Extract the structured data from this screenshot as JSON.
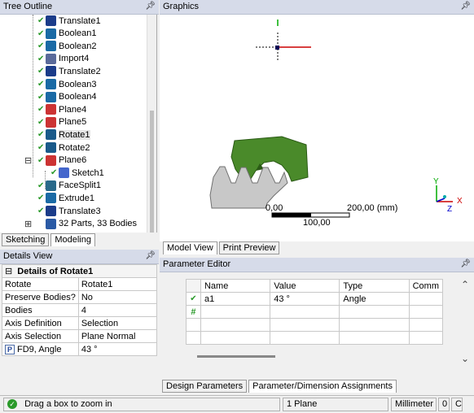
{
  "tree_outline": {
    "title": "Tree Outline",
    "items": [
      {
        "label": "Translate1",
        "icon": "translate-icon"
      },
      {
        "label": "Boolean1",
        "icon": "boolean-icon"
      },
      {
        "label": "Boolean2",
        "icon": "boolean-icon"
      },
      {
        "label": "Import4",
        "icon": "import-icon"
      },
      {
        "label": "Translate2",
        "icon": "translate-icon"
      },
      {
        "label": "Boolean3",
        "icon": "boolean-icon"
      },
      {
        "label": "Boolean4",
        "icon": "boolean-icon"
      },
      {
        "label": "Plane4",
        "icon": "plane-icon"
      },
      {
        "label": "Plane5",
        "icon": "plane-icon"
      },
      {
        "label": "Rotate1",
        "icon": "rotate-icon"
      },
      {
        "label": "Rotate2",
        "icon": "rotate-icon"
      },
      {
        "label": "Plane6",
        "icon": "plane-icon"
      },
      {
        "label": "Sketch1",
        "icon": "sketch-icon"
      },
      {
        "label": "FaceSplit1",
        "icon": "facesplit-icon"
      },
      {
        "label": "Extrude1",
        "icon": "extrude-icon"
      },
      {
        "label": "Translate3",
        "icon": "translate-icon"
      },
      {
        "label": "32 Parts, 33 Bodies",
        "icon": "parts-icon"
      }
    ],
    "tabs": [
      "Sketching",
      "Modeling"
    ],
    "active_tab": "Modeling"
  },
  "graphics": {
    "title": "Graphics",
    "scale_left": "0,00",
    "scale_right": "200,00 (mm)",
    "scale_mid": "100,00",
    "axis_x": "X",
    "axis_y": "Y",
    "axis_z": "Z",
    "tabs": [
      "Model View",
      "Print Preview"
    ],
    "active_tab": "Model View",
    "colors": {
      "green_body": "#4a8a2a",
      "gray_body": "#c8c8c8"
    }
  },
  "details_view": {
    "title": "Details View",
    "header": "Details of Rotate1",
    "rows": [
      {
        "label": "Rotate",
        "value": "Rotate1"
      },
      {
        "label": "Preserve Bodies?",
        "value": "No"
      },
      {
        "label": "Bodies",
        "value": "4"
      },
      {
        "label": "Axis Definition",
        "value": "Selection"
      },
      {
        "label": "Axis Selection",
        "value": "Plane Normal"
      },
      {
        "label": "FD9, Angle",
        "value": "43 °",
        "badge": "P"
      }
    ]
  },
  "parameter_editor": {
    "title": "Parameter Editor",
    "columns": [
      "Name",
      "Value",
      "Type",
      "Comm"
    ],
    "rows": [
      {
        "name": "a1",
        "value": "43 °",
        "type": "Angle"
      }
    ],
    "tabs": [
      "Design Parameters",
      "Parameter/Dimension Assignments"
    ],
    "active_tab": "Design Parameters"
  },
  "status_bar": {
    "message": "Drag a box to zoom in",
    "selection": "1 Plane",
    "units": "Millimeter",
    "val1": "0",
    "val2": "C"
  }
}
